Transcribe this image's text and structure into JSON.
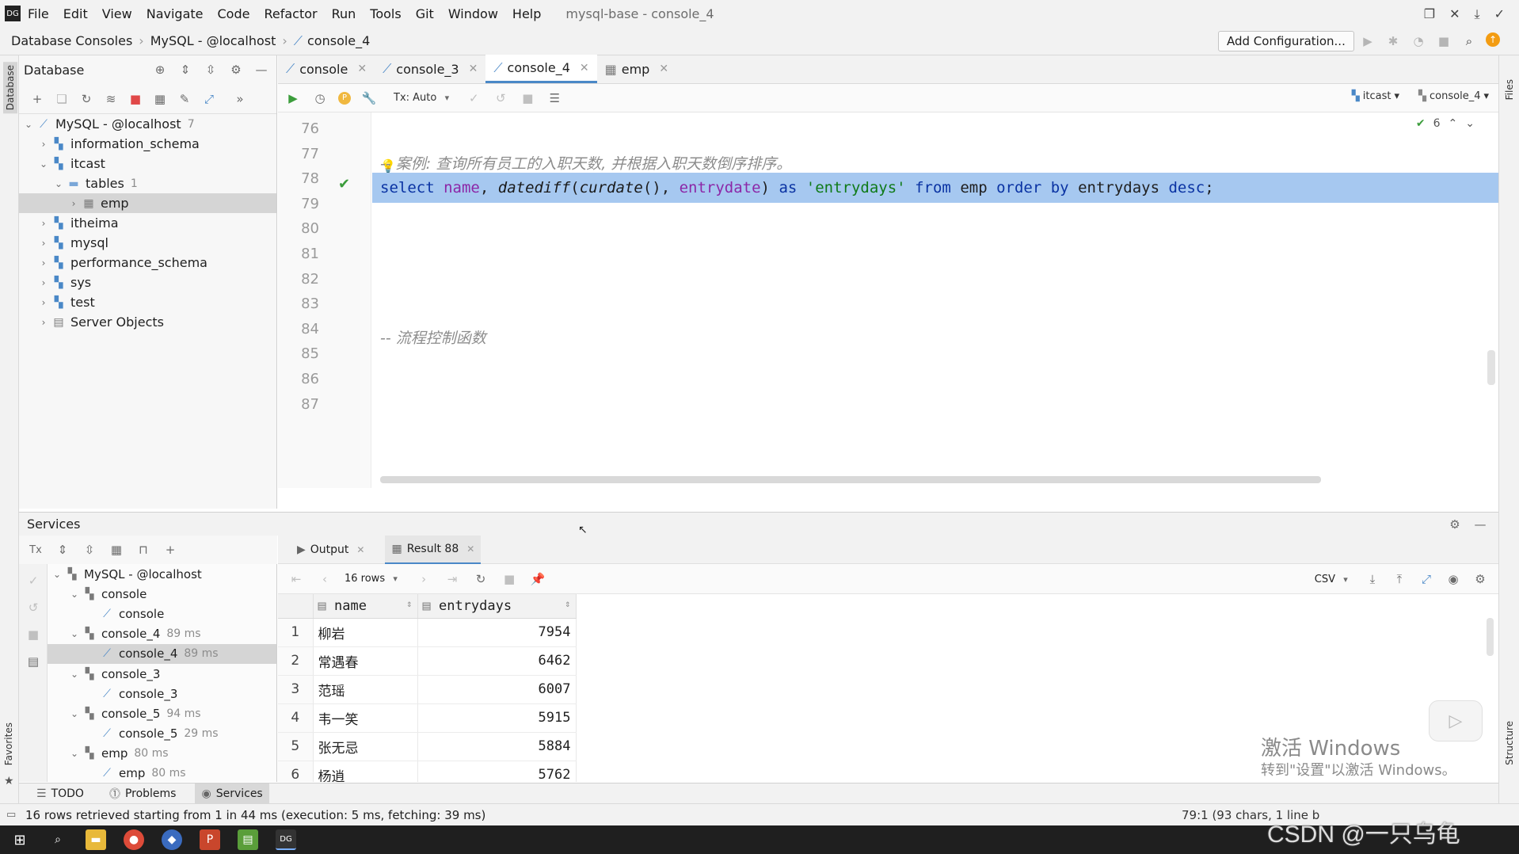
{
  "menubar": {
    "items": [
      "File",
      "Edit",
      "View",
      "Navigate",
      "Code",
      "Refactor",
      "Run",
      "Tools",
      "Git",
      "Window",
      "Help"
    ],
    "window_title": "mysql-base - console_4"
  },
  "navbar": {
    "crumbs": [
      "Database Consoles",
      "MySQL - @localhost",
      "console_4"
    ],
    "add_configuration": "Add Configuration..."
  },
  "left_stripe": {
    "database": "Database",
    "favorites": "Favorites"
  },
  "right_stripe": {
    "files": "Files",
    "structure": "Structure"
  },
  "db_panel": {
    "title": "Database",
    "tree": [
      {
        "label": "MySQL - @localhost",
        "count": "7",
        "depth": 0,
        "arrow": "v",
        "icon": "datasource-icon"
      },
      {
        "label": "information_schema",
        "depth": 1,
        "arrow": ">",
        "icon": "schema-icon"
      },
      {
        "label": "itcast",
        "depth": 1,
        "arrow": "v",
        "icon": "schema-icon"
      },
      {
        "label": "tables",
        "count": "1",
        "depth": 2,
        "arrow": "v",
        "icon": "folder-icon"
      },
      {
        "label": "emp",
        "depth": 3,
        "arrow": ">",
        "icon": "table-icon",
        "selected": true
      },
      {
        "label": "itheima",
        "depth": 1,
        "arrow": ">",
        "icon": "schema-icon"
      },
      {
        "label": "mysql",
        "depth": 1,
        "arrow": ">",
        "icon": "schema-icon"
      },
      {
        "label": "performance_schema",
        "depth": 1,
        "arrow": ">",
        "icon": "schema-icon"
      },
      {
        "label": "sys",
        "depth": 1,
        "arrow": ">",
        "icon": "schema-icon"
      },
      {
        "label": "test",
        "depth": 1,
        "arrow": ">",
        "icon": "schema-icon"
      },
      {
        "label": "Server Objects",
        "depth": 1,
        "arrow": ">",
        "icon": "server-objects-icon"
      }
    ]
  },
  "editor": {
    "tabs": [
      {
        "label": "console",
        "active": false
      },
      {
        "label": "console_3",
        "active": false
      },
      {
        "label": "console_4",
        "active": true
      },
      {
        "label": "emp",
        "active": false
      }
    ],
    "tx_mode": "Tx: Auto",
    "schema_selector": "itcast",
    "console_selector": "console_4",
    "inspection_count": "6",
    "line_numbers": [
      "76",
      "77",
      "78",
      "79",
      "80",
      "81",
      "82",
      "83",
      "84",
      "85",
      "86",
      "87"
    ],
    "comment_line_78": "-- 案例: 查询所有员工的入职天数, 并根据入职天数倒序排序。",
    "sql_line_79": {
      "t1": "select",
      "t2": "name",
      "t3": ",",
      "t4": "datediff",
      "t5": "(",
      "t6": "curdate",
      "t7": "(),",
      "t8": "entrydate",
      "t9": ")",
      "t10": "as",
      "t11": "'entrydays'",
      "t12": "from",
      "t13": "emp",
      "t14": "order by",
      "t15": "entrydays",
      "t16": "desc",
      "t17": ";"
    },
    "comment_line_85": "-- 流程控制函数"
  },
  "services": {
    "title": "Services",
    "tree": [
      {
        "label": "MySQL - @localhost",
        "time": "",
        "depth": 0,
        "arrow": "v"
      },
      {
        "label": "console",
        "time": "",
        "depth": 1,
        "arrow": "v"
      },
      {
        "label": "console",
        "time": "",
        "depth": 2,
        "arrow": ""
      },
      {
        "label": "console_4",
        "time": "89 ms",
        "depth": 1,
        "arrow": "v"
      },
      {
        "label": "console_4",
        "time": "89 ms",
        "depth": 2,
        "arrow": "",
        "selected": true
      },
      {
        "label": "console_3",
        "time": "",
        "depth": 1,
        "arrow": "v"
      },
      {
        "label": "console_3",
        "time": "",
        "depth": 2,
        "arrow": ""
      },
      {
        "label": "console_5",
        "time": "94 ms",
        "depth": 1,
        "arrow": "v"
      },
      {
        "label": "console_5",
        "time": "29 ms",
        "depth": 2,
        "arrow": ""
      },
      {
        "label": "emp",
        "time": "80 ms",
        "depth": 1,
        "arrow": "v"
      },
      {
        "label": "emp",
        "time": "80 ms",
        "depth": 2,
        "arrow": ""
      }
    ],
    "result_tabs": [
      {
        "label": "Output",
        "active": false
      },
      {
        "label": "Result 88",
        "active": true
      }
    ],
    "rows_selector": "16 rows",
    "export_format": "CSV",
    "columns": [
      "name",
      "entrydays"
    ],
    "rows": [
      {
        "n": "1",
        "name": "柳岩",
        "entrydays": "7954"
      },
      {
        "n": "2",
        "name": "常遇春",
        "entrydays": "6462"
      },
      {
        "n": "3",
        "name": "范瑶",
        "entrydays": "6007"
      },
      {
        "n": "4",
        "name": "韦一笑",
        "entrydays": "5915"
      },
      {
        "n": "5",
        "name": "张无忌",
        "entrydays": "5884"
      },
      {
        "n": "6",
        "name": "杨逍",
        "entrydays": "5762"
      }
    ]
  },
  "tool_tabs": [
    {
      "label": "TODO",
      "active": false
    },
    {
      "label": "Problems",
      "active": false
    },
    {
      "label": "Services",
      "active": true
    }
  ],
  "status": {
    "message": "16 rows retrieved starting from 1 in 44 ms (execution: 5 ms, fetching: 39 ms)",
    "position": "79:1 (93 chars, 1 line b"
  },
  "watermark": {
    "line1": "激活 Windows",
    "line2": "转到\"设置\"以激活 Windows。"
  },
  "csdn": "CSDN @一只乌龟"
}
